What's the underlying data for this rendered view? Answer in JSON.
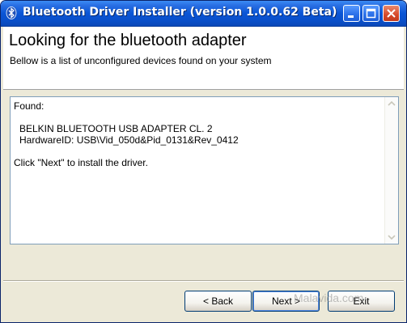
{
  "window": {
    "title": "Bluetooth Driver Installer (version 1.0.0.62 Beta)",
    "titlebar_color": "#0a55d6",
    "close_button_color": "#d6492a"
  },
  "header": {
    "title": "Looking for the bluetooth adapter",
    "subtitle": "Bellow is a list of unconfigured devices found on your system"
  },
  "results": {
    "found_label": "Found:",
    "device_name": "BELKIN BLUETOOTH USB ADAPTER CL. 2",
    "hardware_id": "HardwareID: USB\\Vid_050d&Pid_0131&Rev_0412",
    "instruction": "Click \"Next\" to install the driver."
  },
  "buttons": {
    "back": "< Back",
    "next": "Next >",
    "exit": "Exit"
  },
  "watermark": "Malavida.com",
  "icons": [
    "bluetooth-icon",
    "minimize-icon",
    "maximize-icon",
    "close-icon",
    "scroll-up-icon",
    "scroll-down-icon"
  ]
}
